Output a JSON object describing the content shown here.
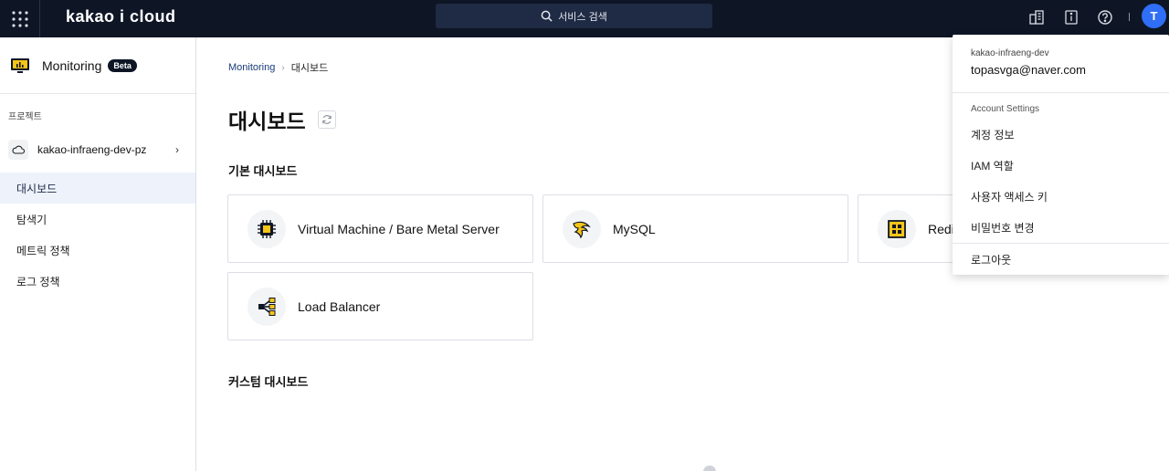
{
  "header": {
    "brand": "kakao i cloud",
    "search_label": "서비스 검색",
    "user_initial": "T"
  },
  "sidebar": {
    "title": "Monitoring",
    "badge": "Beta",
    "project_section_label": "프로젝트",
    "project_name": "kakao-infraeng-dev-pz",
    "items": [
      {
        "label": "대시보드",
        "active": true
      },
      {
        "label": "탐색기",
        "active": false
      },
      {
        "label": "메트릭 정책",
        "active": false
      },
      {
        "label": "로그 정책",
        "active": false
      }
    ]
  },
  "main": {
    "breadcrumb": [
      "Monitoring",
      "대시보드"
    ],
    "page_title": "대시보드",
    "basic_section": "기본 대시보드",
    "custom_section": "커스텀 대시보드",
    "cards": [
      {
        "label": "Virtual Machine / Bare Metal Server",
        "icon": "chip-icon"
      },
      {
        "label": "MySQL",
        "icon": "mysql-icon"
      },
      {
        "label": "Redi",
        "icon": "redis-icon"
      },
      {
        "label": "Load Balancer",
        "icon": "load-balancer-icon"
      }
    ]
  },
  "account_menu": {
    "project": "kakao-infraeng-dev",
    "email": "topasvga@naver.com",
    "heading": "Account Settings",
    "items": [
      "계정 정보",
      "IAM 역할",
      "사용자 액세스 키",
      "비밀번호 변경"
    ],
    "logout": "로그아웃"
  },
  "colors": {
    "topbar": "#0e1626",
    "accent": "#2f6ef5",
    "active_nav": "#eef2fa",
    "icon_yellow": "#f5c518"
  }
}
